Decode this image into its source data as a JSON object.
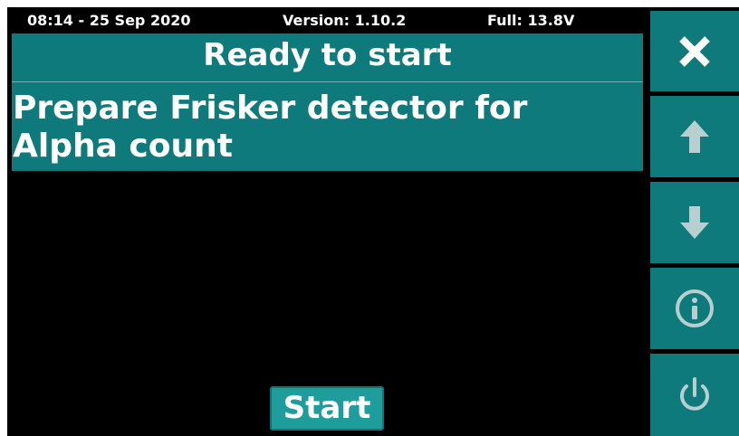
{
  "status_bar": {
    "time": "08:14 - 25 Sep 2020",
    "version": "Version: 1.10.2",
    "power": "Full:  13.8V"
  },
  "header": {
    "title": "Ready to start"
  },
  "message": {
    "line1": "Prepare Frisker detector for",
    "line2": "Alpha count"
  },
  "actions": {
    "start_label": "Start"
  },
  "side_buttons": [
    {
      "icon": "close-icon"
    },
    {
      "icon": "arrow-up-icon"
    },
    {
      "icon": "arrow-down-icon"
    },
    {
      "icon": "info-icon"
    },
    {
      "icon": "power-icon"
    }
  ],
  "colors": {
    "teal": "#0e7a7b",
    "button_teal": "#1f9c9c",
    "background": "#000000",
    "disabled_icon": "#b7cfcf"
  }
}
